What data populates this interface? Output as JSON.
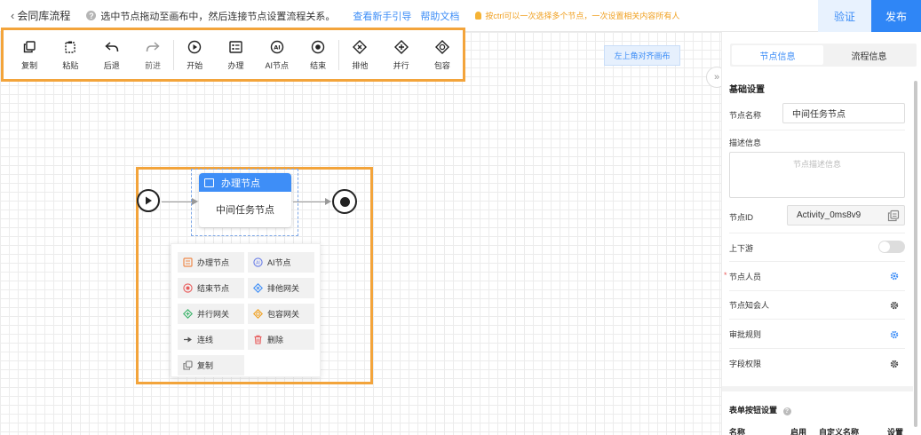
{
  "topbar": {
    "back_label": "会同库流程",
    "hint_text": "选中节点拖动至画布中，然后连接节点设置流程关系。",
    "guide_link": "查看新手引导",
    "help_link": "帮助文档",
    "tip_text": "按ctrl可以一次选择多个节点，一次设置相关内容所有人",
    "verify_label": "验证",
    "publish_label": "发布"
  },
  "toolbar": {
    "items": [
      {
        "label": "复制",
        "icon": "copy-icon"
      },
      {
        "label": "粘贴",
        "icon": "paste-icon"
      },
      {
        "label": "后退",
        "icon": "undo-icon"
      },
      {
        "label": "前进",
        "icon": "redo-icon"
      },
      {
        "label": "开始",
        "icon": "start-icon"
      },
      {
        "label": "办理",
        "icon": "task-icon"
      },
      {
        "label": "AI节点",
        "icon": "ai-icon"
      },
      {
        "label": "结束",
        "icon": "end-icon"
      },
      {
        "label": "排他",
        "icon": "exclusive-gateway-icon"
      },
      {
        "label": "并行",
        "icon": "parallel-gateway-icon"
      },
      {
        "label": "包容",
        "icon": "inclusive-gateway-icon"
      }
    ],
    "align_label": "左上角对齐画布"
  },
  "flow": {
    "task_title": "办理节点",
    "task_body": "中间任务节点"
  },
  "context_menu": {
    "items": [
      {
        "label": "办理节点",
        "icon": "task-icon",
        "color": "#f08a4b"
      },
      {
        "label": "AI节点",
        "icon": "ai-icon",
        "color": "#6a7ee8"
      },
      {
        "label": "结束节点",
        "icon": "end-icon",
        "color": "#e85c5c"
      },
      {
        "label": "排他网关",
        "icon": "exclusive-gateway-icon",
        "color": "#3e8ef7"
      },
      {
        "label": "并行网关",
        "icon": "parallel-gateway-icon",
        "color": "#3bb36a"
      },
      {
        "label": "包容网关",
        "icon": "inclusive-gateway-icon",
        "color": "#f0a020"
      },
      {
        "label": "连线",
        "icon": "connect-icon",
        "color": "#555555"
      },
      {
        "label": "删除",
        "icon": "trash-icon",
        "color": "#e85c5c"
      },
      {
        "label": "复制",
        "icon": "copy-icon",
        "color": "#777777"
      }
    ]
  },
  "panel": {
    "tab_node": "节点信息",
    "tab_process": "流程信息",
    "basic_title": "基础设置",
    "name_label": "节点名称",
    "name_value": "中间任务节点",
    "desc_label": "描述信息",
    "desc_placeholder": "节点描述信息",
    "id_label": "节点ID",
    "id_value": "Activity_0ms8v9",
    "updown_label": "上下游",
    "assignee_label": "节点人员",
    "required_mark": "*",
    "cc_label": "节点知会人",
    "approval_label": "审批规则",
    "field_label": "字段权限",
    "form_btn_title": "表单按钮设置",
    "col_name": "名称",
    "col_enable": "启用",
    "col_custom": "自定义名称",
    "col_setting": "设置"
  },
  "colors": {
    "accent": "#3e8ef7",
    "highlight": "#f3a43b",
    "tip": "#f0a020"
  }
}
